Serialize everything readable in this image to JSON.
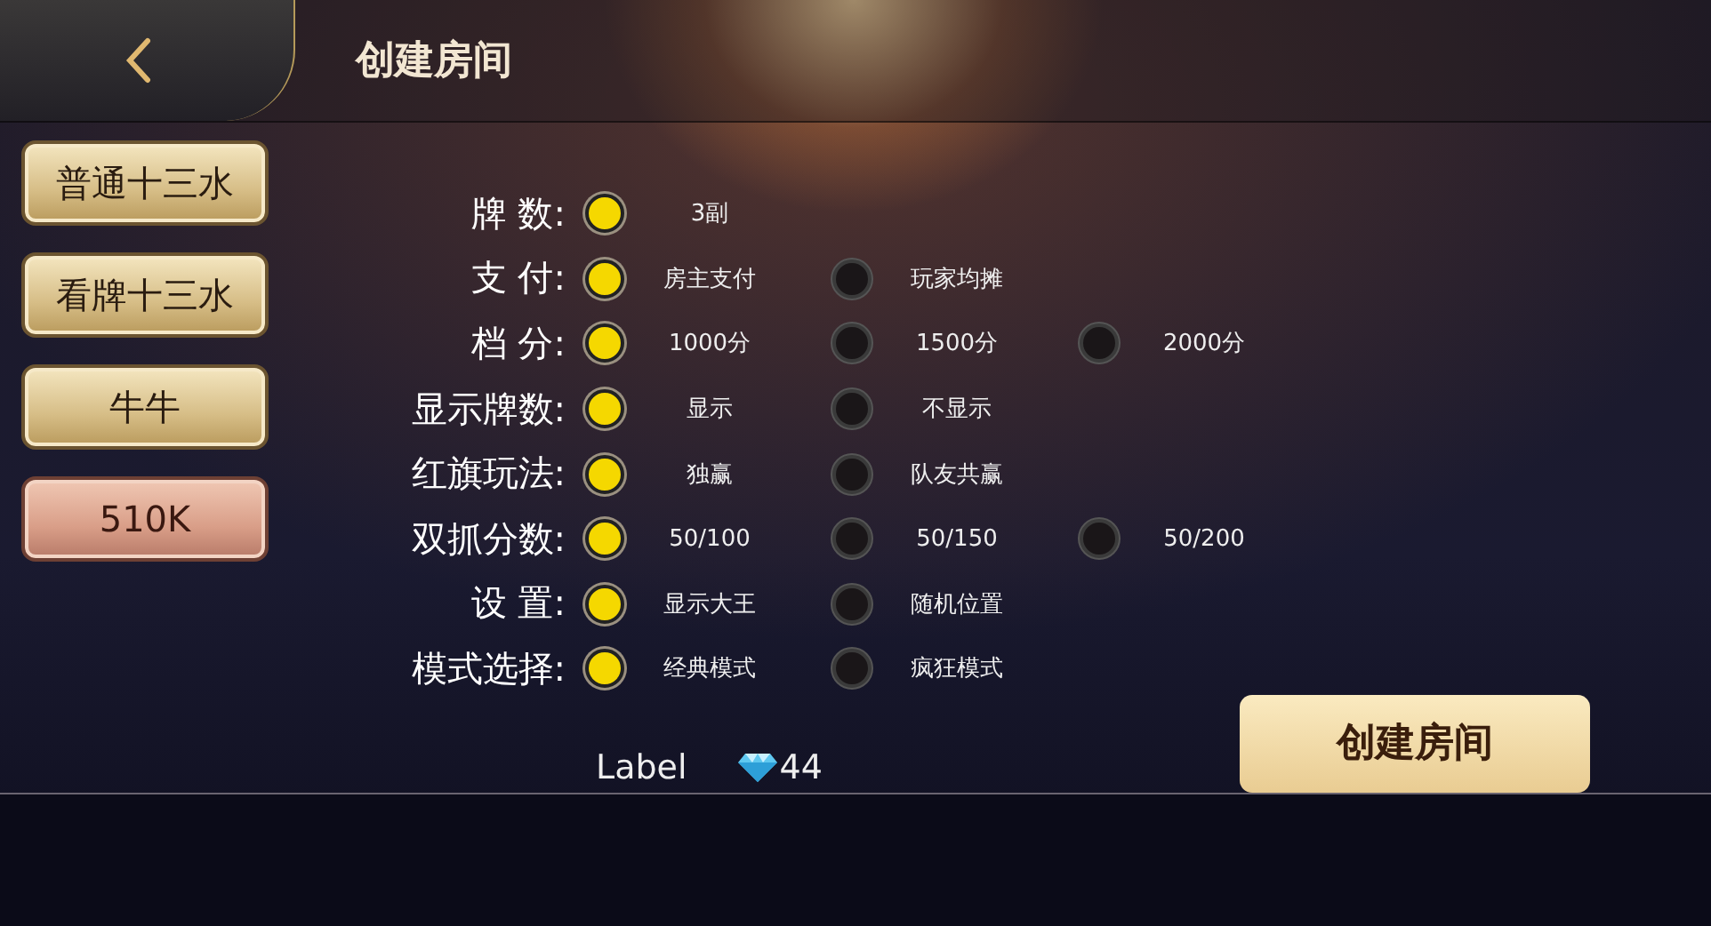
{
  "header": {
    "title": "创建房间"
  },
  "sidebar": {
    "items": [
      {
        "label": "普通十三水",
        "selected": false
      },
      {
        "label": "看牌十三水",
        "selected": false
      },
      {
        "label": "牛牛",
        "selected": false
      },
      {
        "label": "510K",
        "selected": true
      }
    ]
  },
  "settings": [
    {
      "label": "牌 数:",
      "options": [
        {
          "text": "3副",
          "selected": true
        }
      ]
    },
    {
      "label": "支 付:",
      "options": [
        {
          "text": "房主支付",
          "selected": true
        },
        {
          "text": "玩家均摊",
          "selected": false
        }
      ]
    },
    {
      "label": "档 分:",
      "options": [
        {
          "text": "1000分",
          "selected": true
        },
        {
          "text": "1500分",
          "selected": false
        },
        {
          "text": "2000分",
          "selected": false
        }
      ]
    },
    {
      "label": "显示牌数:",
      "options": [
        {
          "text": "显示",
          "selected": true
        },
        {
          "text": "不显示",
          "selected": false
        }
      ]
    },
    {
      "label": "红旗玩法:",
      "options": [
        {
          "text": "独赢",
          "selected": true
        },
        {
          "text": "队友共赢",
          "selected": false
        }
      ]
    },
    {
      "label": "双抓分数:",
      "options": [
        {
          "text": "50/100",
          "selected": true
        },
        {
          "text": "50/150",
          "selected": false
        },
        {
          "text": "50/200",
          "selected": false
        }
      ]
    },
    {
      "label": "设 置:",
      "options": [
        {
          "text": "显示大王",
          "selected": true
        },
        {
          "text": "随机位置",
          "selected": false
        }
      ]
    },
    {
      "label": "模式选择:",
      "options": [
        {
          "text": "经典模式",
          "selected": true
        },
        {
          "text": "疯狂模式",
          "selected": false
        }
      ]
    }
  ],
  "cost": {
    "label": "Label",
    "amount": "44"
  },
  "create_button": {
    "label": "创建房间"
  }
}
